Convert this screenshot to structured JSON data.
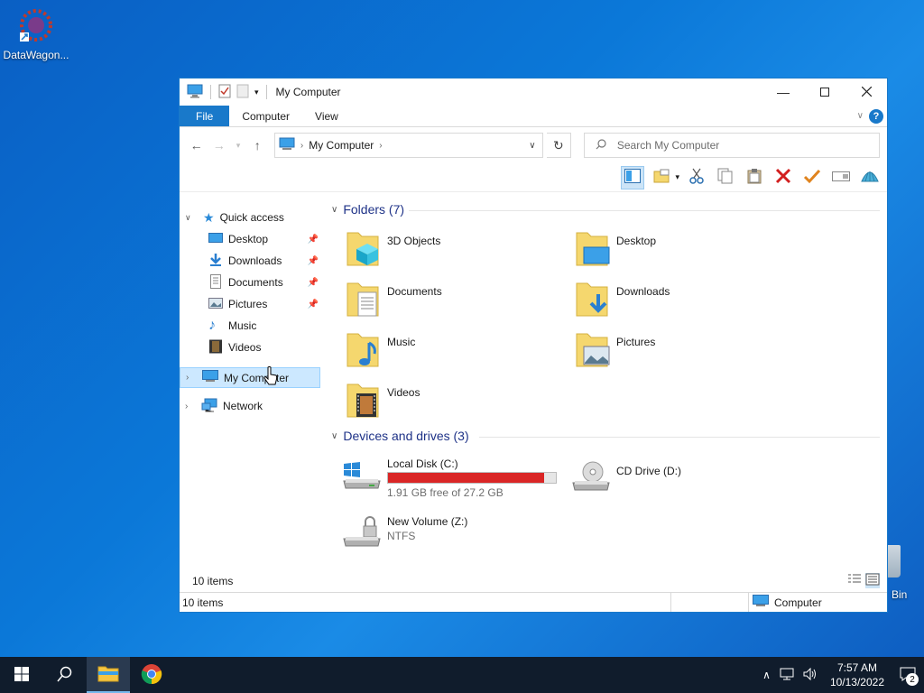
{
  "desktop": {
    "icons": [
      {
        "label": "DataWagon..."
      },
      {
        "label": "Bin"
      }
    ]
  },
  "window": {
    "title": "My Computer",
    "ribbon": {
      "tabs": [
        "File",
        "Computer",
        "View"
      ]
    },
    "address": {
      "path": "My Computer"
    },
    "search": {
      "placeholder": "Search My Computer"
    }
  },
  "nav": {
    "quick_access": "Quick access",
    "items": [
      "Desktop",
      "Downloads",
      "Documents",
      "Pictures",
      "Music",
      "Videos"
    ],
    "my_computer": "My Computer",
    "network": "Network"
  },
  "groups": {
    "folders_header": "Folders (7)",
    "folders": [
      "3D Objects",
      "Desktop",
      "Documents",
      "Downloads",
      "Music",
      "Pictures",
      "Videos"
    ],
    "devices_header": "Devices and drives (3)",
    "drives": [
      {
        "name": "Local Disk (C:)",
        "sub": "1.91 GB free of 27.2 GB",
        "used_fraction": 0.93
      },
      {
        "name": "CD Drive (D:)"
      },
      {
        "name": "New Volume (Z:)",
        "sub": "NTFS"
      }
    ]
  },
  "status": {
    "inner_count": "10 items",
    "bar_count": "10 items",
    "location": "Computer"
  },
  "taskbar": {
    "time": "7:57 AM",
    "date": "10/13/2022",
    "notifications": "2"
  },
  "colors": {
    "accent": "#1979ca",
    "drive_bar": "#da2626",
    "group_header": "#1e3287"
  }
}
